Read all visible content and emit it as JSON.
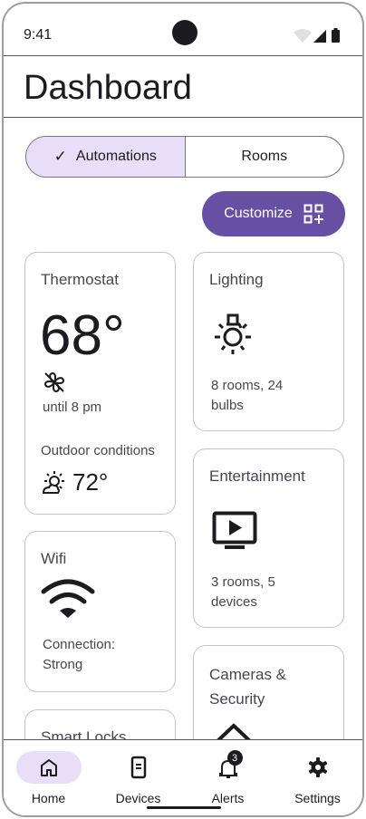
{
  "status_bar": {
    "time": "9:41"
  },
  "app_bar": {
    "title": "Dashboard"
  },
  "segmented": {
    "options": [
      {
        "label": "Automations",
        "selected": true
      },
      {
        "label": "Rooms",
        "selected": false
      }
    ]
  },
  "customize_button": {
    "label": "Customize",
    "icon": "dashboard-add-icon"
  },
  "cards": {
    "thermostat": {
      "title": "Thermostat",
      "temperature": "68°",
      "mode_icon": "fan-off-icon",
      "until": "until 8 pm",
      "outdoor_label": "Outdoor conditions",
      "outdoor_icon": "partly-cloudy-icon",
      "outdoor_temp": "72°"
    },
    "lighting": {
      "title": "Lighting",
      "icon": "lightbulb-icon",
      "subtitle_line1": "8 rooms, 24",
      "subtitle_line2": "bulbs"
    },
    "entertainment": {
      "title": "Entertainment",
      "icon": "tv-play-icon",
      "subtitle_line1": "3 rooms, 5",
      "subtitle_line2": "devices"
    },
    "wifi": {
      "title": "Wifi",
      "icon": "wifi-icon",
      "subtitle_line1": "Connection:",
      "subtitle_line2": "Strong"
    },
    "cameras": {
      "title_line1": "Cameras &",
      "title_line2": "Security",
      "icon": "home-security-icon"
    },
    "smart_locks": {
      "title": "Smart Locks"
    }
  },
  "bottom_nav": {
    "items": [
      {
        "label": "Home",
        "icon": "home-icon",
        "active": true
      },
      {
        "label": "Devices",
        "icon": "devices-icon",
        "active": false
      },
      {
        "label": "Alerts",
        "icon": "bell-icon",
        "active": false,
        "badge": "3"
      },
      {
        "label": "Settings",
        "icon": "gear-icon",
        "active": false
      }
    ]
  },
  "colors": {
    "primary": "#6750a4",
    "secondary_container": "#e8def8",
    "outline": "#7a757f"
  }
}
